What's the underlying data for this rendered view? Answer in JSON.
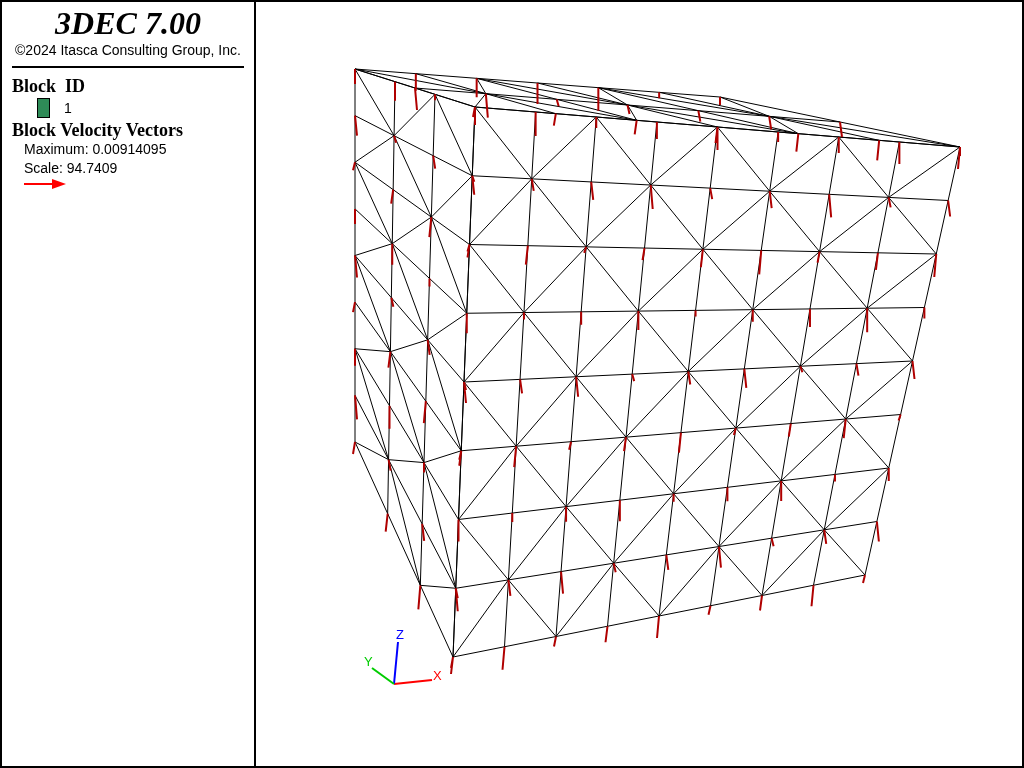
{
  "legend": {
    "title": "3DEC 7.00",
    "copyright": "©2024 Itasca Consulting Group, Inc.",
    "block_id": {
      "heading": "Block  ID",
      "items": [
        {
          "label": "1",
          "color": "#2e8b57"
        }
      ]
    },
    "vectors": {
      "heading": "Block Velocity Vectors",
      "maximum": "Maximum: 0.00914095",
      "scale": "Scale: 94.7409"
    }
  },
  "axes": {
    "x": "X",
    "y": "Y",
    "z": "Z"
  }
}
